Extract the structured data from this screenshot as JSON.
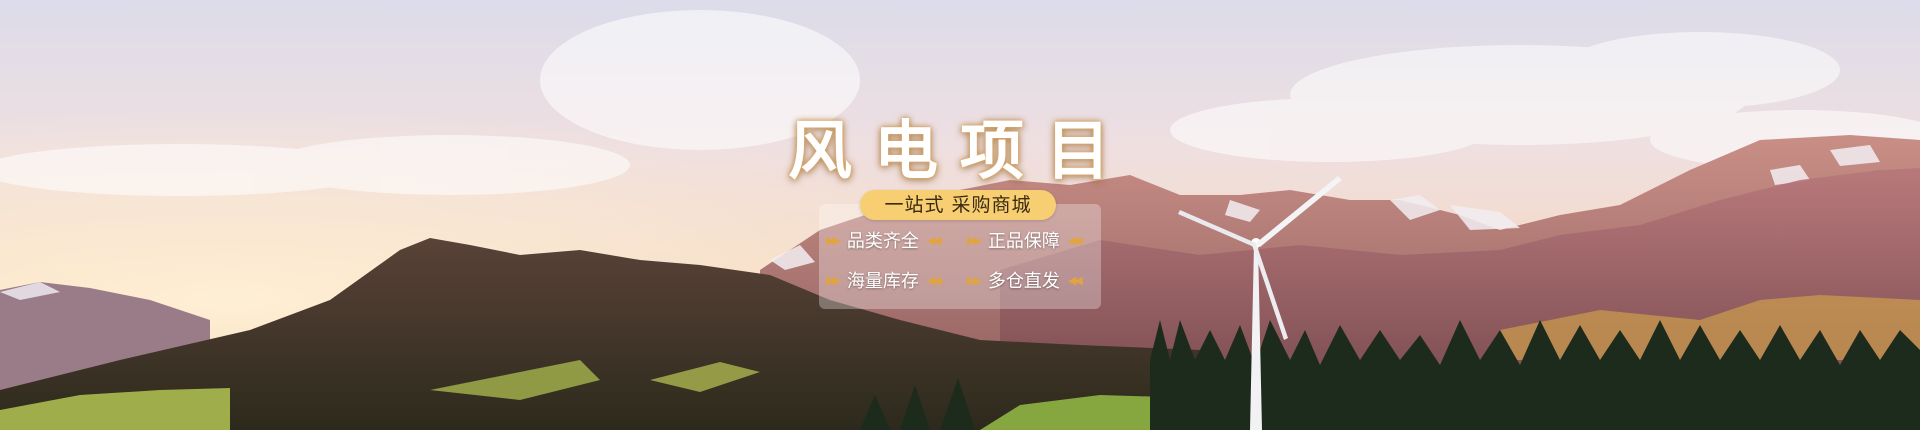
{
  "banner": {
    "title": "风电项目",
    "tagline": "一站式  采购商城",
    "features": [
      "品类齐全",
      "正品保障",
      "海量库存",
      "多仓直发"
    ],
    "arrow_right": "▶▶",
    "arrow_left": "◀◀"
  },
  "colors": {
    "title_glow": "#e3b36e",
    "pill_bg": "#f7cf72",
    "arrow": "#e2a43c"
  },
  "icons": [
    "wind-turbine-icon",
    "arrow-right-icon",
    "arrow-left-icon"
  ]
}
